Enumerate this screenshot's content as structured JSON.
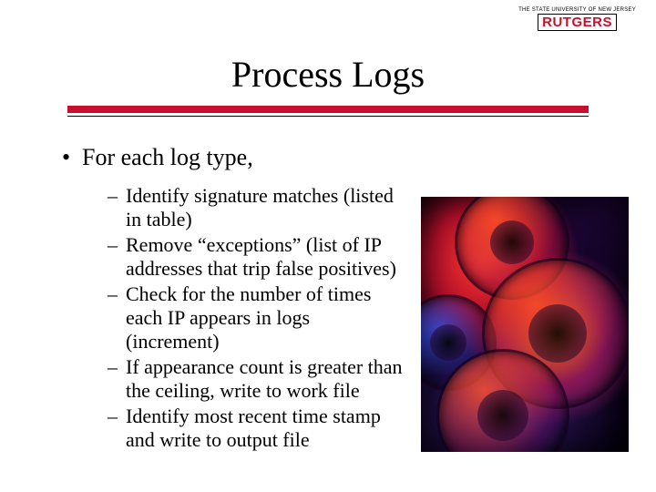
{
  "logo": {
    "tagline": "THE STATE UNIVERSITY OF NEW JERSEY",
    "name": "RUTGERS"
  },
  "title": "Process Logs",
  "bullets": {
    "lvl1": "For each log type,",
    "lvl2": [
      "Identify signature matches (listed in table)",
      "Remove “exceptions” (list of IP addresses that trip false positives)",
      "Check for the number of times each IP appears in logs (increment)",
      "If appearance count is greater than the ceiling, write to work file",
      "Identify most recent time stamp and write to output file"
    ]
  },
  "image": {
    "alt": "gears-photo"
  }
}
